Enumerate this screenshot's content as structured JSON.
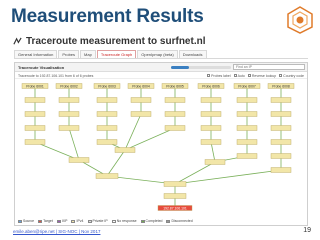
{
  "slide": {
    "title": "Measurement Results",
    "page_number": "19",
    "footer": "emile.aben@ripe.net | SIG-NOC | Nov 2017"
  },
  "page": {
    "heading": "Traceroute measurement to surfnet.nl",
    "heading_icon": "traceroute-icon"
  },
  "tabs": [
    {
      "label": "General Information",
      "active": false
    },
    {
      "label": "Probes",
      "active": false
    },
    {
      "label": "Map",
      "active": false
    },
    {
      "label": "Traceroute Graph",
      "active": true
    },
    {
      "label": "OpenIpmap (beta)",
      "active": false
    },
    {
      "label": "Downloads",
      "active": false
    }
  ],
  "panel": {
    "title": "Traceroute Visualisation",
    "search_placeholder": "Find an IP",
    "info": "Traceroute to 192.87.106.101 from 6 of 6 probes",
    "options": [
      "Probes label",
      "Auto",
      "Reverse lookup",
      "Country code"
    ],
    "slider_value": 0.3
  },
  "graph": {
    "probes": [
      "Probe 6001",
      "Probe 6002",
      "Probe 6003",
      "Probe 6004",
      "Probe 6005",
      "Probe 6006",
      "Probe 6007",
      "Probe 6008"
    ],
    "target": "192.87.106.101"
  },
  "legend": {
    "items": [
      {
        "label": "Source",
        "color": "#5aa0e6"
      },
      {
        "label": "Target",
        "color": "#e74c3c"
      },
      {
        "label": "IXP",
        "color": "#9b59b6"
      },
      {
        "label": "IPv4",
        "color": "#f2e6a8"
      },
      {
        "label": "Private IP",
        "color": "#dddddd"
      },
      {
        "label": "No response",
        "color": "#ffffff"
      },
      {
        "label": "Completed",
        "color": "#6fae4e"
      },
      {
        "label": "Disconnected",
        "color": "#999999"
      }
    ]
  },
  "colors": {
    "title": "#1f4e79",
    "node_fill": "#f2e6a8",
    "node_stroke": "#b5a45a",
    "edge": "#7ab05a",
    "active_tab": "#cc2222"
  }
}
